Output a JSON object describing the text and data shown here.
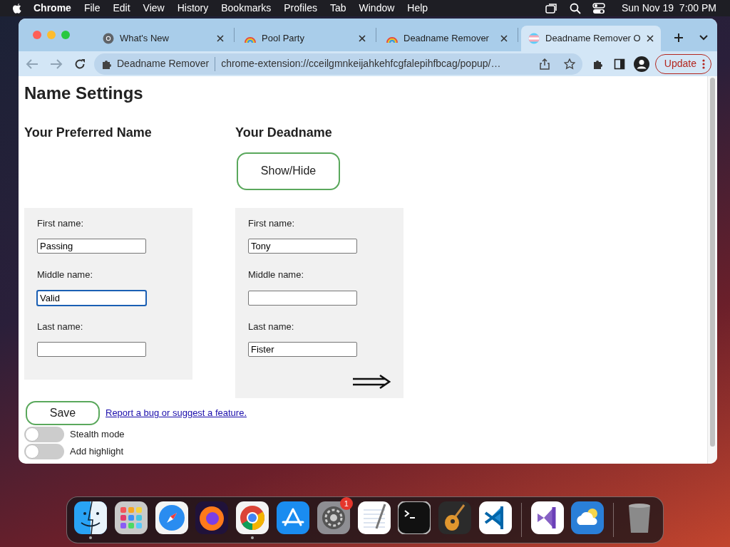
{
  "menu_bar": {
    "app": "Chrome",
    "menus": [
      "File",
      "Edit",
      "View",
      "History",
      "Bookmarks",
      "Profiles",
      "Tab",
      "Window",
      "Help"
    ],
    "clock": "Sun Nov 19  7:00 PM"
  },
  "browser": {
    "tabs": [
      {
        "title": "What's New",
        "kind": "chrome",
        "selected": false
      },
      {
        "title": "Pool Party",
        "kind": "rainbow",
        "selected": false
      },
      {
        "title": "Deadname Remover",
        "kind": "rainbow",
        "selected": false
      },
      {
        "title": "Deadname Remover O",
        "kind": "flag",
        "selected": true
      }
    ],
    "site_chip": "Deadname Remover",
    "url": "chrome-extension://cceilgmnkeijahkehfcgfalepihfbcag/popup/…",
    "update_button": "Update"
  },
  "page": {
    "title": "Name Settings",
    "preferred": {
      "heading": "Your Preferred Name",
      "fields": [
        {
          "label": "First name:",
          "value": "Passing",
          "focused": false
        },
        {
          "label": "Middle name:",
          "value": "Valid",
          "focused": true
        },
        {
          "label": "Last name:",
          "focused": false
        }
      ]
    },
    "deadname": {
      "heading": "Your Deadname",
      "toggle_button": "Show/Hide",
      "fields": [
        {
          "label": "First name:",
          "value": "Tony",
          "focused": false
        },
        {
          "label": "Middle name:",
          "focused": false
        },
        {
          "label": "Last name:",
          "value": "Fister",
          "focused": false
        }
      ]
    },
    "save_button": "Save",
    "report_link": "Report a bug or suggest a feature.",
    "switches": [
      {
        "label": "Stealth mode",
        "on": false
      },
      {
        "label": "Add highlight",
        "on": false
      }
    ]
  },
  "dock": [
    {
      "kind": "finder",
      "running": true
    },
    {
      "kind": "launchpad",
      "running": false
    },
    {
      "kind": "safari",
      "running": false
    },
    {
      "kind": "firefox",
      "running": false
    },
    {
      "kind": "chrome",
      "running": true
    },
    {
      "kind": "appstore",
      "running": false
    },
    {
      "kind": "settings",
      "running": false,
      "badge": "1"
    },
    {
      "kind": "textedit",
      "running": false
    },
    {
      "kind": "terminal",
      "running": false
    },
    {
      "kind": "garageband",
      "running": false
    },
    {
      "kind": "vscode",
      "running": false
    },
    {
      "kind": "separator"
    },
    {
      "kind": "visualstudio",
      "running": false
    },
    {
      "kind": "weather",
      "running": false
    },
    {
      "kind": "separator"
    },
    {
      "kind": "trash",
      "running": false
    }
  ]
}
